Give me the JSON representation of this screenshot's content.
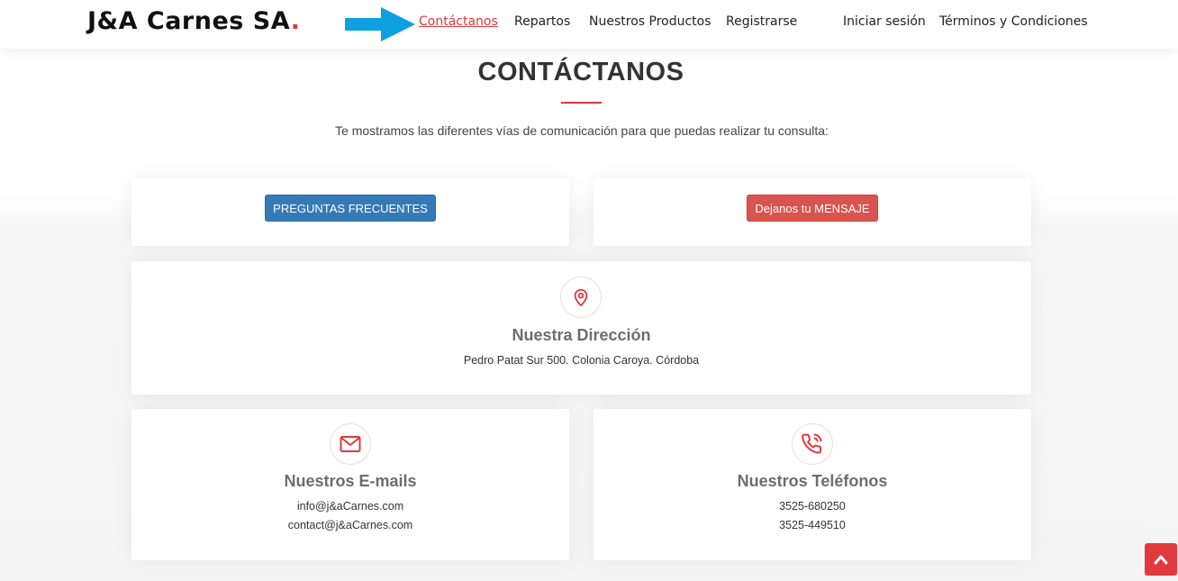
{
  "header": {
    "logo_text": "J&A Carnes SA",
    "logo_dot": ".",
    "nav": [
      {
        "label": "Contáctanos",
        "active": true
      },
      {
        "label": "Repartos"
      },
      {
        "label": "Nuestros Productos"
      },
      {
        "label": "Registrarse"
      },
      {
        "label": "Iniciar sesión"
      },
      {
        "label": "Términos y Condiciones"
      }
    ]
  },
  "main": {
    "title": "CONTÁCTANOS",
    "subtitle": "Te mostramos las diferentes vías de comunicación para que puedas realizar tu consulta:",
    "faq_button": "PREGUNTAS FRECUENTES",
    "message_button": "Dejanos tu MENSAJE",
    "address": {
      "heading": "Nuestra Dirección",
      "text": "Pedro Patat Sur 500. Colonia Caroya. Córdoba"
    },
    "emails": {
      "heading": "Nuestros E-mails",
      "lines": [
        "info@j&aCarnes.com",
        "contact@j&aCarnes.com"
      ]
    },
    "phones": {
      "heading": "Nuestros Teléfonos",
      "lines": [
        "3525-680250",
        "3525-449510"
      ]
    }
  },
  "colors": {
    "accent": "#e03a3c",
    "primary_button": "#337ab7",
    "danger_button": "#d9534f",
    "arrow": "#0ea0e0"
  },
  "icons": {
    "arrow": "arrow-right-icon",
    "address": "map-pin-icon",
    "email": "envelope-icon",
    "phone": "phone-ringing-icon",
    "scroll_top": "chevron-up-icon"
  }
}
